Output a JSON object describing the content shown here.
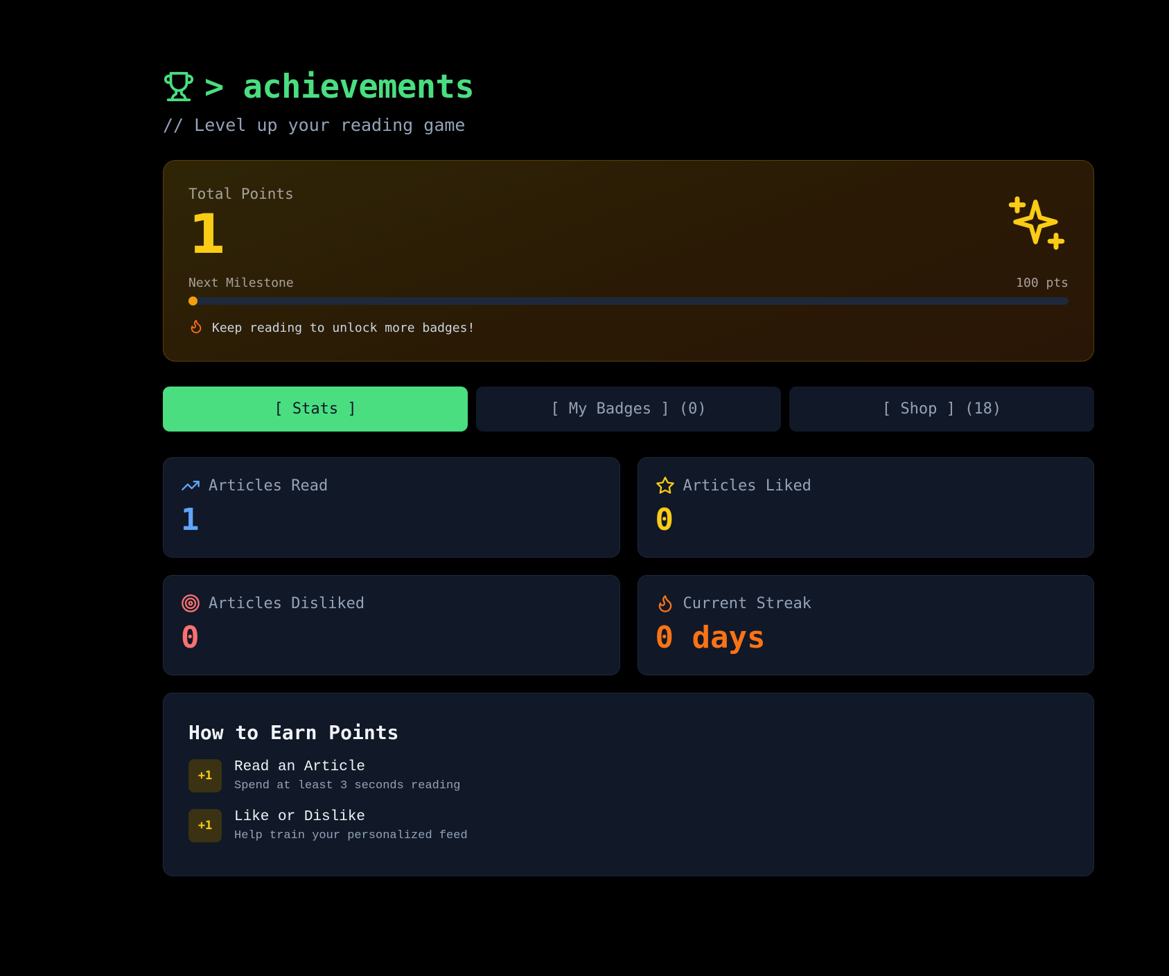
{
  "header": {
    "title": "> achievements",
    "subtitle": "// Level up your reading game",
    "icon": "trophy-icon"
  },
  "points": {
    "label": "Total Points",
    "value": "1",
    "milestone_label": "Next Milestone",
    "milestone_target": "100 pts",
    "progress_fraction": 0.01,
    "hint": "Keep reading to unlock more badges!",
    "icon": "sparkles-icon"
  },
  "tabs": [
    {
      "label": "[ Stats ]",
      "active": true
    },
    {
      "label": "[ My Badges ] (0)",
      "active": false
    },
    {
      "label": "[ Shop ] (18)",
      "active": false
    }
  ],
  "stats": {
    "read": {
      "label": "Articles Read",
      "value": "1",
      "icon": "trending-up-icon",
      "color": "#60a5fa"
    },
    "liked": {
      "label": "Articles Liked",
      "value": "0",
      "icon": "star-icon",
      "color": "#facc15"
    },
    "disliked": {
      "label": "Articles Disliked",
      "value": "0",
      "icon": "target-icon",
      "color": "#f87171"
    },
    "streak": {
      "label": "Current Streak",
      "value": "0 days",
      "icon": "flame-icon",
      "color": "#f97316"
    }
  },
  "earn": {
    "title": "How to Earn Points",
    "items": [
      {
        "badge": "+1",
        "title": "Read an Article",
        "desc": "Spend at least 3 seconds reading"
      },
      {
        "badge": "+1",
        "title": "Like or Dislike",
        "desc": "Help train your personalized feed"
      }
    ]
  },
  "colors": {
    "accent": "#4ade80",
    "gold": "#facc15",
    "background": "#000000",
    "card": "#111827"
  }
}
